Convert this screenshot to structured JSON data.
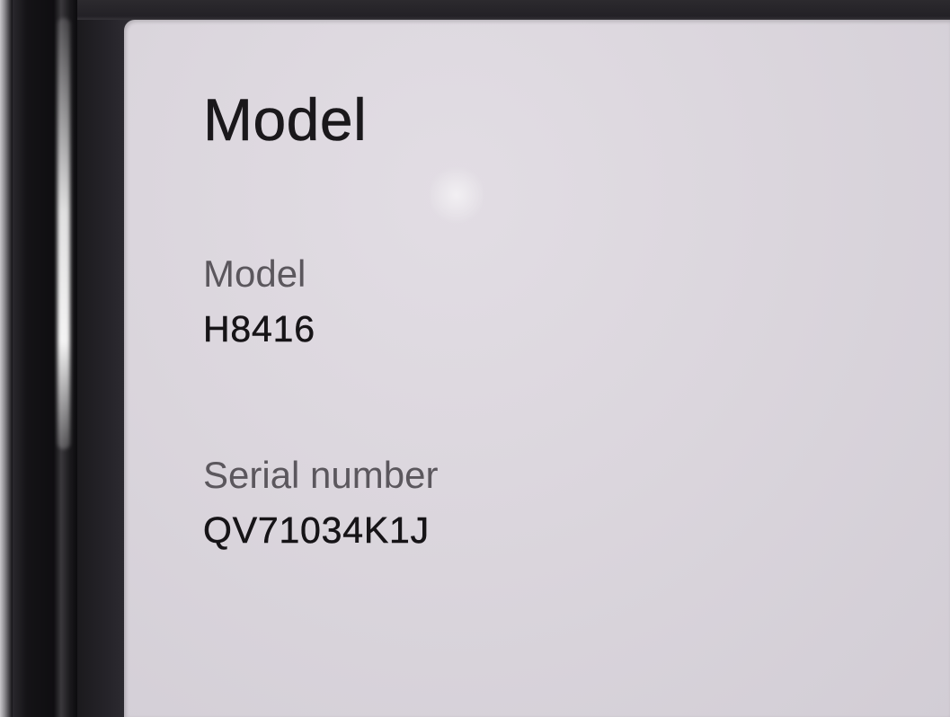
{
  "page": {
    "title": "Model"
  },
  "info": {
    "model": {
      "label": "Model",
      "value": "H8416"
    },
    "serial": {
      "label": "Serial number",
      "value": "QV71034K1J"
    }
  }
}
